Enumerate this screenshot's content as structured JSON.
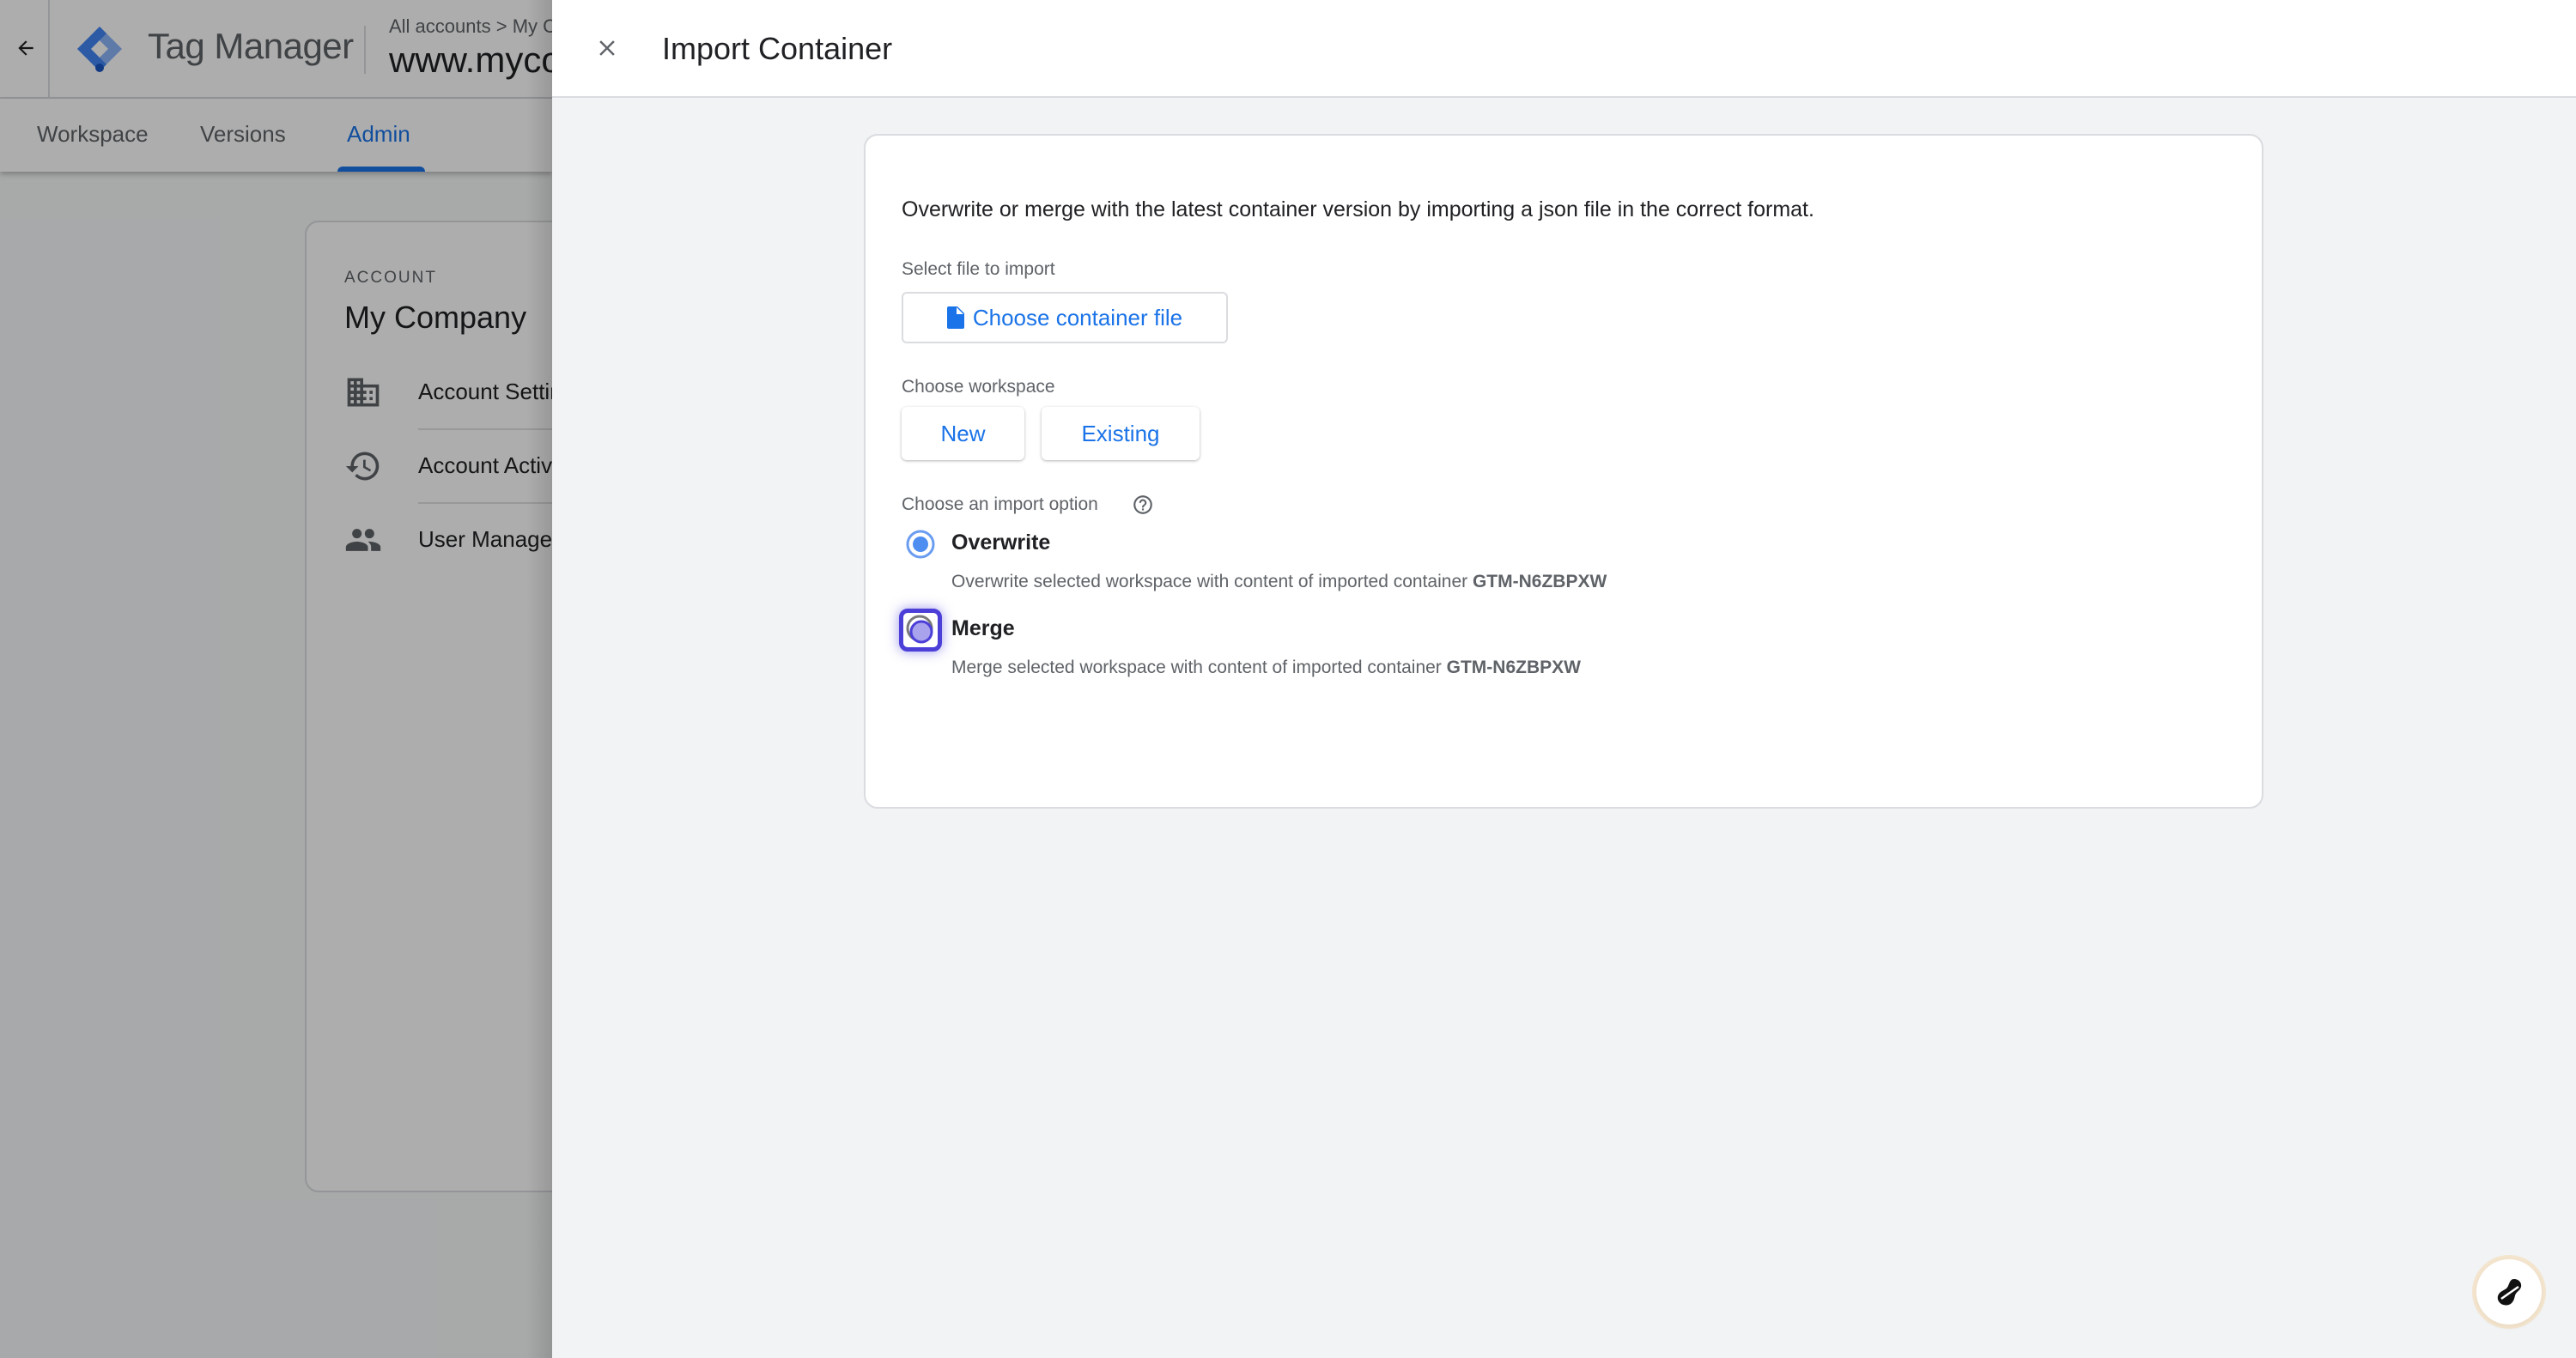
{
  "app": {
    "name": "Tag Manager",
    "breadcrumb": "All accounts > My Company",
    "container_name": "www.mycompany.com"
  },
  "tabs": [
    {
      "label": "Workspace",
      "active": false
    },
    {
      "label": "Versions",
      "active": false
    },
    {
      "label": "Admin",
      "active": true
    }
  ],
  "account": {
    "section_label": "ACCOUNT",
    "name": "My Company",
    "items": [
      {
        "label": "Account Settings",
        "icon": "building-icon"
      },
      {
        "label": "Account Activity",
        "icon": "history-icon"
      },
      {
        "label": "User Management",
        "icon": "people-icon"
      }
    ]
  },
  "panel": {
    "title": "Import Container",
    "description": "Overwrite or merge with the latest container version by importing a json file in the correct format.",
    "file_label": "Select file to import",
    "file_button": "Choose container file",
    "workspace_label": "Choose workspace",
    "workspace_options": [
      "New",
      "Existing"
    ],
    "import_option_label": "Choose an import option",
    "options": [
      {
        "label": "Overwrite",
        "description": "Overwrite selected workspace with content of imported container ",
        "container_id": "GTM-N6ZBPXW",
        "selected": true
      },
      {
        "label": "Merge",
        "description": "Merge selected workspace with content of imported container ",
        "container_id": "GTM-N6ZBPXW",
        "selected": false
      }
    ]
  },
  "colors": {
    "accent": "#1a73e8",
    "focus_ring": "#4b3fd8"
  }
}
